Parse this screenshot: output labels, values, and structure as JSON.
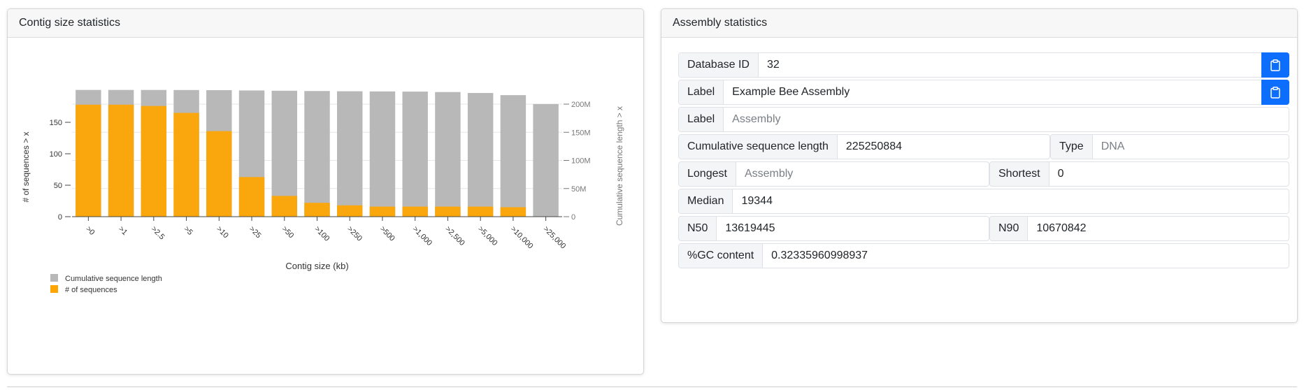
{
  "chart_card": {
    "title": "Contig size statistics"
  },
  "stats_card": {
    "title": "Assembly statistics",
    "database_id": {
      "label": "Database ID",
      "value": "32"
    },
    "label_1": {
      "label": "Label",
      "value": "Example Bee Assembly"
    },
    "label_2": {
      "label": "Label",
      "placeholder": "Assembly"
    },
    "cumulative_length": {
      "label": "Cumulative sequence length",
      "value": "225250884"
    },
    "type": {
      "label": "Type",
      "placeholder": "DNA"
    },
    "longest": {
      "label": "Longest",
      "placeholder": "Assembly"
    },
    "shortest": {
      "label": "Shortest",
      "value": "0"
    },
    "median": {
      "label": "Median",
      "value": "19344"
    },
    "n50": {
      "label": "N50",
      "value": "13619445"
    },
    "n90": {
      "label": "N90",
      "value": "10670842"
    },
    "gc": {
      "label": "%GC content",
      "value": "0.32335960998937"
    }
  },
  "chart_data": {
    "type": "bar",
    "xlabel": "Contig size (kb)",
    "ylabel": "# of sequences > x",
    "y2label": "Cumulative sequence length > x",
    "categories": [
      ">0",
      ">1",
      ">2.5",
      ">5",
      ">10",
      ">25",
      ">50",
      ">100",
      ">250",
      ">500",
      ">1,000",
      ">2,500",
      ">5,000",
      ">10,000",
      ">25,000"
    ],
    "series": [
      {
        "name": "Cumulative sequence length",
        "axis": "right",
        "color": "#b8b8b8",
        "values": [
          225.25,
          225.25,
          225.2,
          225.1,
          224.9,
          224.3,
          223.8,
          223.3,
          222.9,
          222.6,
          222.3,
          221.5,
          219.8,
          216.0,
          200.2
        ]
      },
      {
        "name": "# of sequences",
        "axis": "left",
        "color": "#ffa500",
        "values": [
          178,
          178,
          176,
          165,
          136,
          63,
          33,
          22,
          18,
          16,
          16,
          16,
          16,
          15,
          0
        ]
      }
    ],
    "ylim": [
      0,
      180
    ],
    "y_ticks": [
      0,
      50,
      100,
      150
    ],
    "y2lim": [
      0,
      200
    ],
    "y2_ticks": [
      0,
      50,
      100,
      150,
      200
    ],
    "y2_tick_labels": [
      "0",
      "50M",
      "100M",
      "150M",
      "200M"
    ],
    "legend_position": "bottom-left",
    "grid": true
  }
}
